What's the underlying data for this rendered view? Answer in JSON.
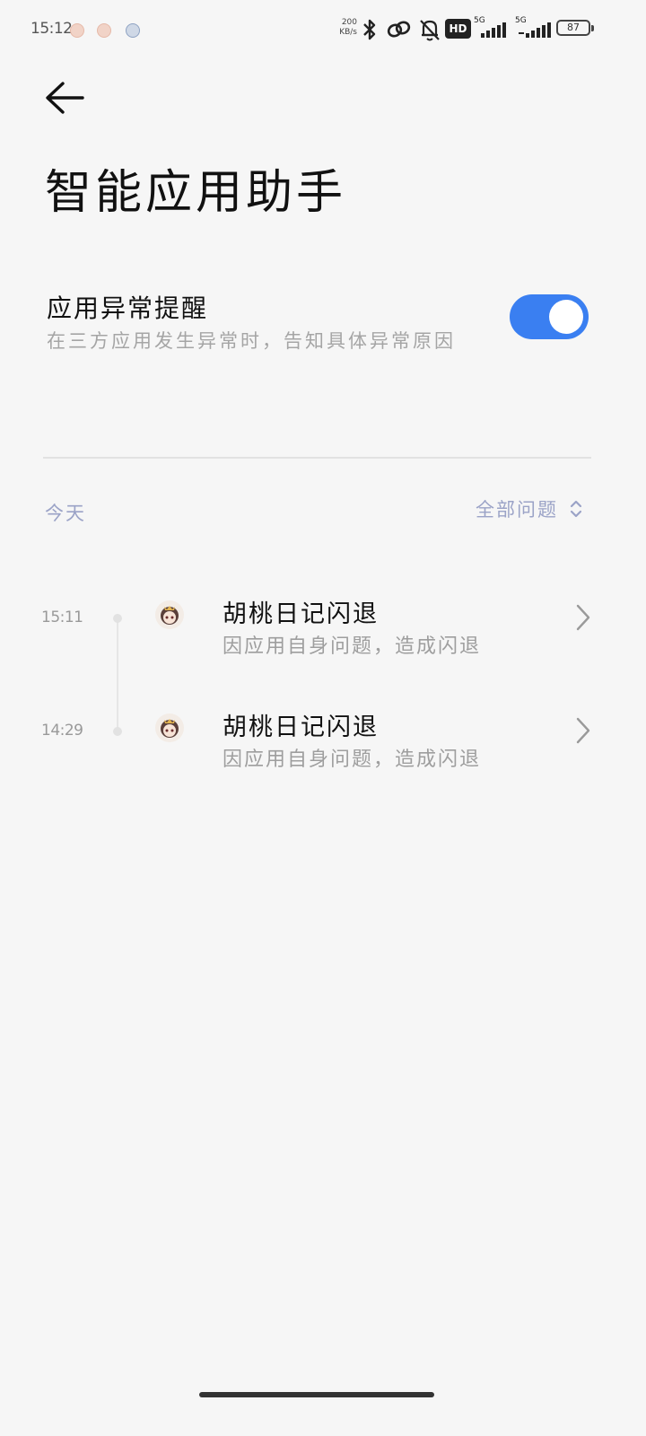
{
  "status_bar": {
    "time": "15:12",
    "net_speed_value": "200",
    "net_speed_unit": "KB/s",
    "hd_badge": "HD",
    "sim1_label": "5G",
    "sim2_label": "5G",
    "battery_level": "87",
    "icons": [
      "notification-app-icon",
      "notification-app-icon",
      "compass-icon",
      "bluetooth-icon",
      "link-icon",
      "bell-muted-icon",
      "signal-icon",
      "signal-icon",
      "battery-icon"
    ]
  },
  "header": {
    "back_icon": "arrow-left-icon",
    "title": "智能应用助手"
  },
  "setting": {
    "title": "应用异常提醒",
    "description": "在三方应用发生异常时，告知具体异常原因",
    "enabled": true,
    "accent_color": "#3a7ff1"
  },
  "list": {
    "section_label": "今天",
    "filter_label": "全部问题",
    "events": [
      {
        "time": "15:11",
        "app_name": "胡桃日记闪退",
        "reason": "因应用自身问题，造成闪退"
      },
      {
        "time": "14:29",
        "app_name": "胡桃日记闪退",
        "reason": "因应用自身问题，造成闪退"
      }
    ]
  }
}
